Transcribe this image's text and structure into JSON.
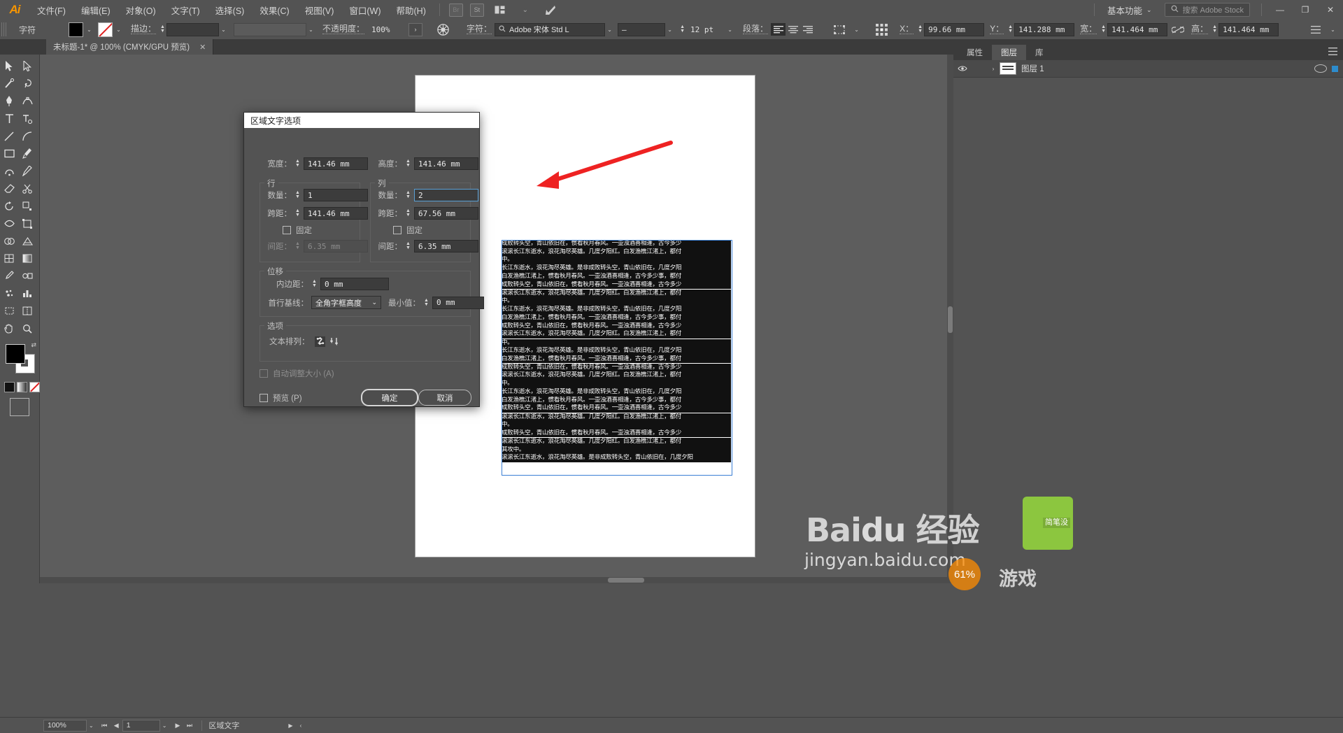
{
  "app": {
    "logo": "Ai",
    "menus": [
      {
        "label": "文件(F)"
      },
      {
        "label": "编辑(E)"
      },
      {
        "label": "对象(O)"
      },
      {
        "label": "文字(T)"
      },
      {
        "label": "选择(S)"
      },
      {
        "label": "效果(C)"
      },
      {
        "label": "视图(V)"
      },
      {
        "label": "窗口(W)"
      },
      {
        "label": "帮助(H)"
      }
    ],
    "menu_icons": [
      {
        "name": "bridge-icon",
        "label": "Br"
      },
      {
        "name": "stock-icon",
        "label": "St"
      },
      {
        "name": "arrange-documents-icon",
        "label": "▤"
      },
      {
        "name": "arrange-chevron-icon",
        "label": "⌄"
      },
      {
        "name": "adobe-app-icon",
        "label": "◣"
      }
    ],
    "workspace": {
      "label": "基本功能",
      "chevron": "⌄"
    },
    "stock_search": {
      "icon": "search-icon",
      "placeholder": "搜索 Adobe Stock",
      "value": ""
    },
    "window_controls": {
      "minimize": "—",
      "restore": "❐",
      "close": "✕"
    }
  },
  "controlbar": {
    "panel_label": "字符",
    "fill_color": "#000000",
    "stroke_label": "描边：",
    "stroke_value": "",
    "stroke_profile": "",
    "opacity_label": "不透明度：",
    "opacity_value": "100%",
    "opacity_arrow": "›",
    "recolor_icon": "recolor-artwork-icon",
    "char_label": "字符：",
    "font_family": "Adobe 宋体 Std L",
    "font_style": "—",
    "font_size": "12 pt",
    "para_label": "段落：",
    "align_left": "≡",
    "align_center": "≡",
    "align_right": "≡",
    "transform_icon": "transform-icon",
    "ref_point_icon": "reference-point-icon",
    "x_label": "X：",
    "x_value": "99.66 mm",
    "y_label": "Y：",
    "y_value": "141.288 mm",
    "w_label": "宽：",
    "w_value": "141.464 mm",
    "link_icon": "unlink-proportions-icon",
    "h_label": "高：",
    "h_value": "141.464 mm"
  },
  "document_tab": {
    "title": "未标题-1* @ 100% (CMYK/GPU 预览)",
    "close": "✕"
  },
  "tools": [
    {
      "name": "selection-tool",
      "glyph": "selection"
    },
    {
      "name": "direct-selection-tool",
      "glyph": "direct"
    },
    {
      "name": "magic-wand-tool",
      "glyph": "wand"
    },
    {
      "name": "lasso-tool",
      "glyph": "lasso"
    },
    {
      "name": "pen-tool",
      "glyph": "pen"
    },
    {
      "name": "curvature-tool",
      "glyph": "curve"
    },
    {
      "name": "type-tool",
      "glyph": "type"
    },
    {
      "name": "touch-type-tool",
      "glyph": "touchtype"
    },
    {
      "name": "line-segment-tool",
      "glyph": "line"
    },
    {
      "name": "arc-tool",
      "glyph": "arc"
    },
    {
      "name": "rectangle-tool",
      "glyph": "rect"
    },
    {
      "name": "paintbrush-tool",
      "glyph": "brush"
    },
    {
      "name": "shaper-tool",
      "glyph": "shaper"
    },
    {
      "name": "pencil-tool",
      "glyph": "pencil"
    },
    {
      "name": "eraser-tool",
      "glyph": "eraser"
    },
    {
      "name": "rotate-tool",
      "glyph": "rotate"
    },
    {
      "name": "scale-tool",
      "glyph": "scale"
    },
    {
      "name": "width-tool",
      "glyph": "width"
    },
    {
      "name": "free-transform-tool",
      "glyph": "freetrans"
    },
    {
      "name": "shape-builder-tool",
      "glyph": "shapebuild"
    },
    {
      "name": "perspective-grid-tool",
      "glyph": "perspective"
    },
    {
      "name": "mesh-tool",
      "glyph": "mesh"
    },
    {
      "name": "gradient-tool",
      "glyph": "gradient"
    },
    {
      "name": "eyedropper-tool",
      "glyph": "eyedropper"
    },
    {
      "name": "blend-tool",
      "glyph": "blend"
    },
    {
      "name": "symbol-sprayer-tool",
      "glyph": "symbol"
    },
    {
      "name": "column-graph-tool",
      "glyph": "graph"
    },
    {
      "name": "artboard-tool",
      "glyph": "artboard"
    },
    {
      "name": "slice-tool",
      "glyph": "slice"
    },
    {
      "name": "hand-tool",
      "glyph": "hand"
    },
    {
      "name": "zoom-tool",
      "glyph": "zoom"
    }
  ],
  "layers_panel": {
    "tabs": [
      {
        "label": "属性",
        "active": false
      },
      {
        "label": "图层",
        "active": true
      },
      {
        "label": "库",
        "active": false
      }
    ],
    "menu_icon": "panel-menu-icon",
    "rows": [
      {
        "name": "图层 1",
        "eye": "👁",
        "expand": "›"
      }
    ]
  },
  "dialog": {
    "title": "区域文字选项",
    "width_label": "宽度：",
    "width_value": "141.46 mm",
    "height_label": "高度：",
    "height_value": "141.46 mm",
    "rows_group": "行",
    "cols_group": "列",
    "rows": {
      "count_label": "数量：",
      "count_value": "1",
      "span_label": "跨距：",
      "span_value": "141.46 mm",
      "fixed_label": "固定",
      "fixed_checked": false,
      "gutter_label": "间距：",
      "gutter_value": "6.35 mm"
    },
    "cols": {
      "count_label": "数量：",
      "count_value": "2",
      "span_label": "跨距：",
      "span_value": "67.56 mm",
      "fixed_label": "固定",
      "fixed_checked": false,
      "gutter_label": "间距：",
      "gutter_value": "6.35 mm"
    },
    "offset_group": "位移",
    "inset_label": "内边距：",
    "inset_value": "0 mm",
    "baseline_label": "首行基线：",
    "baseline_value": "全角字框高度",
    "baseline_chevron": "⌄",
    "min_label": "最小值：",
    "min_value": "0 mm",
    "options_group": "选项",
    "textflow_label": "文本排列：",
    "textflow_icons": [
      "text-flow-rows-icon",
      "text-flow-columns-icon"
    ],
    "autosize_label": "自动调整大小 (A)",
    "autosize_checked": false,
    "preview_label": "预览 (P)",
    "preview_checked": false,
    "ok_label": "确定",
    "cancel_label": "取消"
  },
  "canvas": {
    "text_lines": [
      "成败转头空，青山依旧在，惯看秋月春风。一壶浊酒喜相逢，古今多少",
      "滚滚长江东逝水，浪花淘尽英雄。几度夕阳红。白发渔樵江渚上，都付",
      "中。",
      "长江东逝水，浪花淘尽英雄。是非成败转头空，青山依旧在，几度夕阳",
      "白发渔樵江渚上，惯看秋月春风。一壶浊酒喜相逢，古今多少事，都付",
      "成败转头空，青山依旧在，惯看秋月春风。一壶浊酒喜相逢，古今多少",
      "滚滚长江东逝水，浪花淘尽英雄。几度夕阳红。白发渔樵江渚上，都付",
      "中。",
      "长江东逝水，浪花淘尽英雄。是非成败转头空，青山依旧在，几度夕阳",
      "白发渔樵江渚上，惯看秋月春风。一壶浊酒喜相逢，古今多少事，都付",
      "成败转头空，青山依旧在，惯看秋月春风。一壶浊酒喜相逢，古今多少",
      "滚滚长江东逝水，浪花淘尽英雄。几度夕阳红。白发渔樵江渚上，都付",
      "中。",
      "长江东逝水，浪花淘尽英雄。是非成败转头空，青山依旧在，几度夕阳",
      "白发渔樵江渚上，惯看秋月春风。一壶浊酒喜相逢，古今多少事，都付",
      "成败转头空，青山依旧在，惯看秋月春风。一壶浊酒喜相逢，古今多少",
      "滚滚长江东逝水，浪花淘尽英雄。几度夕阳红。白发渔樵江渚上，都付",
      "中。",
      "长江东逝水，浪花淘尽英雄。是非成败转头空，青山依旧在，几度夕阳",
      "白发渔樵江渚上，惯看秋月春风。一壶浊酒喜相逢，古今多少事，都付",
      "成败转头空，青山依旧在，惯看秋月春风。一壶浊酒喜相逢，古今多少",
      "滚滚长江东逝水，浪花淘尽英雄。几度夕阳红。白发渔樵江渚上，都付",
      "中。",
      "成败转头空，青山依旧在，惯看秋月春风。一壶浊酒喜相逢，古今多少",
      "滚滚长江东逝水，浪花淘尽英雄。几度夕阳红。白发渔樵江渚上，都付",
      "其攻中。",
      "滚滚长江东逝水，浪花淘尽英雄。是非成败转头空，青山依旧在，几度夕阳"
    ]
  },
  "statusbar": {
    "zoom_value": "100%",
    "zoom_chevron": "⌄",
    "nav_first": "⏮",
    "nav_prev": "◀",
    "page_value": "1",
    "page_chevron": "⌄",
    "nav_next": "▶",
    "nav_last": "⏭",
    "status_text": "区域文字",
    "status_arrow": "▶",
    "status_chevron": "‹"
  },
  "watermarks": {
    "baidu_brand": "Bai",
    "baidu_du": "du",
    "baidu_exp": "经验",
    "url": "jingyan.baidu.com",
    "green_text": "简笔没",
    "circle_text": "61%",
    "game_text": "游戏"
  },
  "colors": {
    "accent_red": "#ee2222",
    "panel_bg": "#535353",
    "canvas_bg": "#5d5d5d",
    "field_bg": "#3c3c3c",
    "focus_blue": "#5a9fd4",
    "orange": "#f79500",
    "green": "#8cc63f"
  }
}
